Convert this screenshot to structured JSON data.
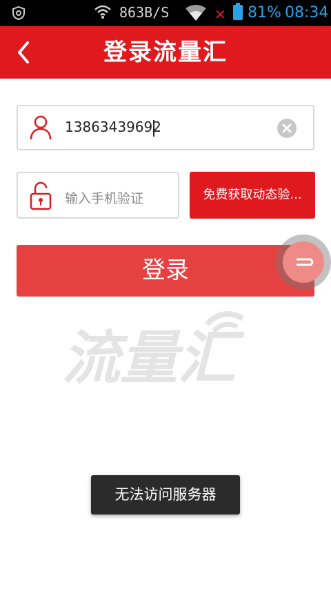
{
  "status_bar": {
    "net_speed": "863B/S",
    "battery": "81%",
    "time": "08:34"
  },
  "header": {
    "title": "登录流量汇"
  },
  "form": {
    "phone_value": "13863439692",
    "code_placeholder": "输入手机验证",
    "get_code_label": "免费获取动态验...",
    "login_label": "登录"
  },
  "watermark": {
    "logo_text": "流量汇"
  },
  "toast": {
    "message": "无法访问服务器"
  },
  "colors": {
    "brand_red": "#e0191f",
    "login_red": "#e64141",
    "status_blue": "#27a3e6"
  },
  "icons": [
    "shield-icon",
    "wifi-icon",
    "no-signal-icon",
    "battery-icon",
    "back-icon",
    "user-icon",
    "clear-icon",
    "lock-icon",
    "float-assist-icon"
  ]
}
